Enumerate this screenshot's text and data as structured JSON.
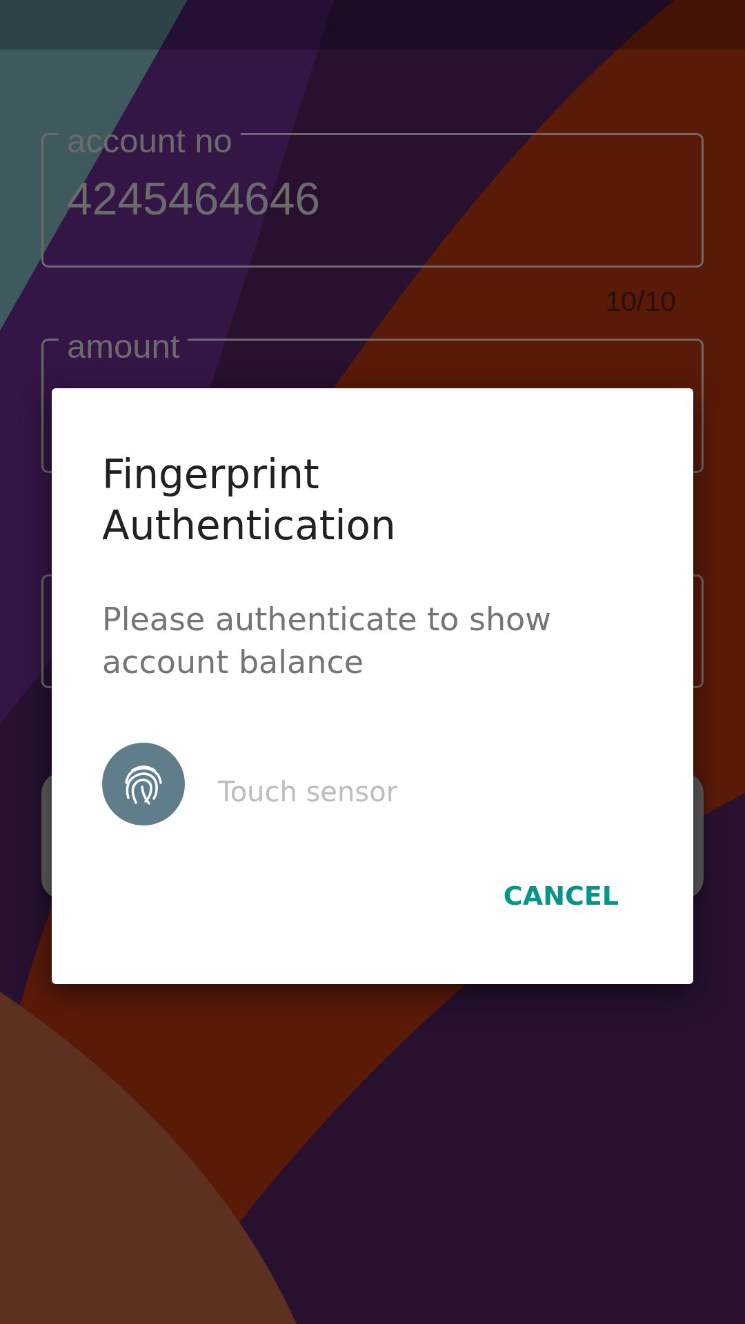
{
  "form": [
    {
      "kind": "text_field",
      "label": "account no",
      "value": "4245464646",
      "counter": "10/10"
    },
    {
      "kind": "text_field",
      "label": "amount"
    },
    {
      "kind": "text_field"
    },
    {
      "kind": "button"
    }
  ],
  "dialog": {
    "title": "Fingerprint Authentication",
    "message": "Please authenticate to show account balance",
    "sensor_hint": "Touch sensor",
    "buttons": [
      "CANCEL"
    ]
  }
}
